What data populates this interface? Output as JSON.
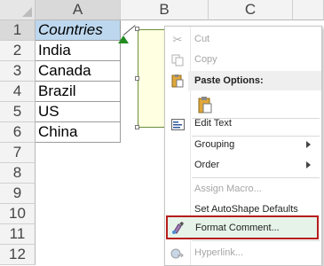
{
  "columns": [
    "A",
    "B",
    "C"
  ],
  "rows": [
    "1",
    "2",
    "3",
    "4",
    "5",
    "6",
    "7",
    "8",
    "9",
    "10",
    "11",
    "12"
  ],
  "cells": [
    "Countries",
    "India",
    "Canada",
    "Brazil",
    "US",
    "China"
  ],
  "menu": {
    "cut": "Cut",
    "copy": "Copy",
    "paste_options": "Paste Options:",
    "edit_text": "Edit Text",
    "grouping": "Grouping",
    "order": "Order",
    "assign_macro": "Assign Macro...",
    "set_autoshape_defaults": "Set AutoShape Defaults",
    "format_comment": "Format Comment...",
    "hyperlink": "Hyperlink..."
  },
  "colors": {
    "header_highlight": "#bdd7ee",
    "comment_fill": "#ffffe1",
    "indicator": "#228b22",
    "highlight_border": "#b71c1c"
  }
}
